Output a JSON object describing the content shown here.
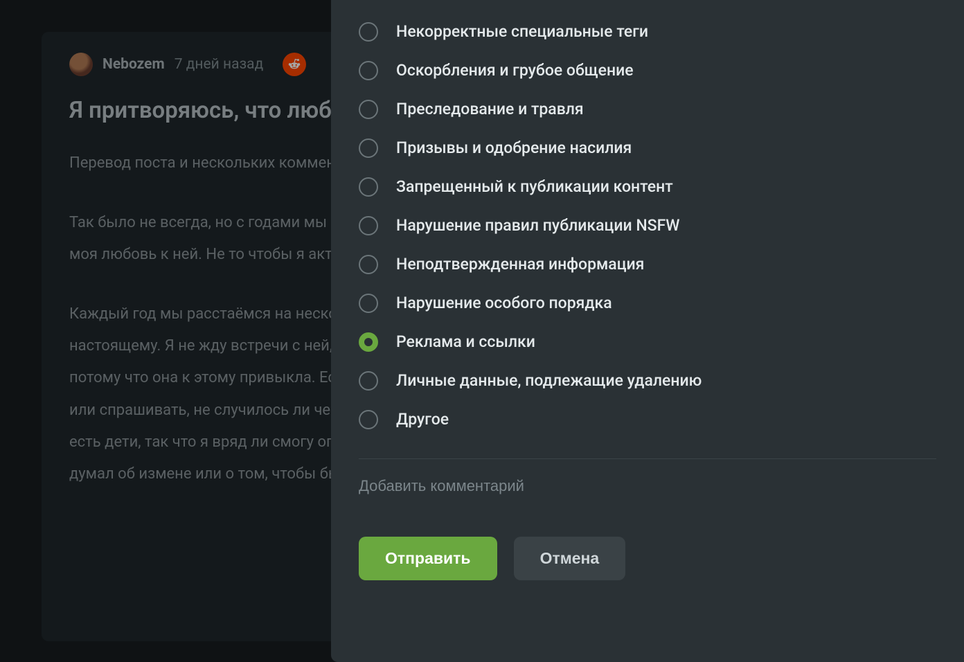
{
  "post": {
    "author": "Nebozem",
    "time": "7 дней назад",
    "title": "Я притворяюсь, что люблю свою жену, чтобы наша семья жила мирно",
    "intro": "Перевод поста и нескольких комментариев с Reddit",
    "para1": "Так было не всегда, но с годами мы как-то разошлись, стали далеки друг от друга, и вместе с этим угасала и моя любовь к ней. Не то чтобы я активно не люблю ее, я просто равнодушен.",
    "para2": "Каждый год мы расстаёмся на несколько недель из-за наших графиков, и я больше не скучаю по ней по-настоящему. Я не жду встречи с ней, когда мы разлучены. Однако я продолжаю говорить ей, что скучаю, потому что она к этому привыкла. Если я в течение какого-то времени не звоню ей, она начинает волноваться или спрашивать, не случилось ли чего, поэтому я продолжаю лгать ей об этом. Она неплохой человек, и у нас есть дети, так что я вряд ли смогу оправдать расставание, поскольку это полностью разрушит её. Я никогда не думал об измене или о том, чтобы быть с кем-то другим."
  },
  "modal": {
    "options": [
      {
        "label": "Некорректные специальные теги"
      },
      {
        "label": "Оскорбления и грубое общение"
      },
      {
        "label": "Преследование и травля"
      },
      {
        "label": "Призывы и одобрение насилия"
      },
      {
        "label": "Запрещенный к публикации контент"
      },
      {
        "label": "Нарушение правил публикации NSFW"
      },
      {
        "label": "Неподтвержденная информация"
      },
      {
        "label": "Нарушение особого порядка"
      },
      {
        "label": "Реклама и ссылки"
      },
      {
        "label": "Личные данные, подлежащие удалению"
      },
      {
        "label": "Другое"
      }
    ],
    "selected_index": 8,
    "comment_placeholder": "Добавить комментарий",
    "submit": "Отправить",
    "cancel": "Отмена"
  },
  "colors": {
    "accent": "#6aa83f",
    "source": "#ff4500"
  }
}
